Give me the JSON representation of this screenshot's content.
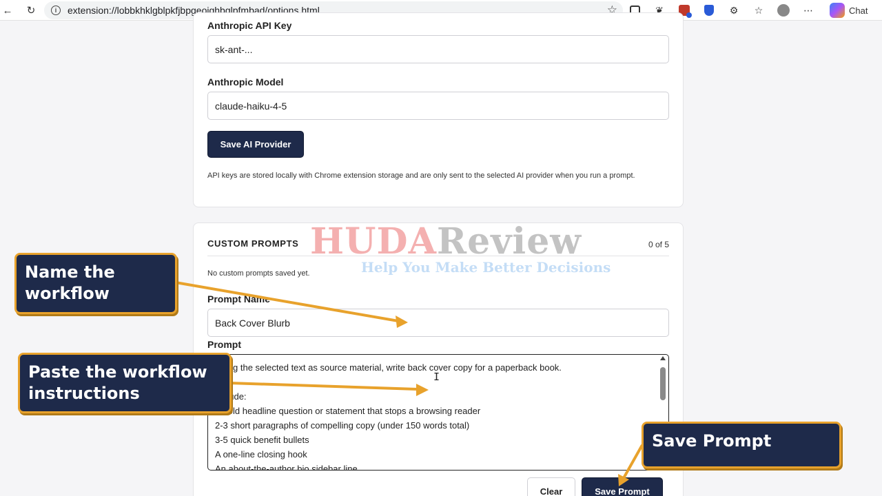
{
  "browser": {
    "url": "extension://lobbkhklgblpkfjbpgeoighbglpfmbad/options.html",
    "chat_label": "Chat",
    "icons": [
      "back-icon",
      "reload-icon",
      "info-icon",
      "star-icon",
      "reader-icon",
      "extension-icon",
      "badge-icon",
      "shield-icon",
      "puzzle-icon",
      "favorites-icon",
      "profile-icon",
      "more-icon",
      "copilot-icon"
    ]
  },
  "ai_provider": {
    "api_key_label": "Anthropic API Key",
    "api_key_value": "sk-ant-...",
    "model_label": "Anthropic Model",
    "model_value": "claude-haiku-4-5",
    "save_button": "Save AI Provider",
    "note": "API keys are stored locally with Chrome extension storage and are only sent to the selected AI provider when you run a prompt."
  },
  "custom_prompts": {
    "heading": "CUSTOM PROMPTS",
    "count": "0 of 5",
    "empty_note": "No custom prompts saved yet.",
    "name_label": "Prompt Name",
    "name_value": "Back Cover Blurb",
    "prompt_label": "Prompt",
    "prompt_lines": [
      "Using the selected text as source material, write back cover copy for a paperback book.",
      "",
      "Include:",
      "A bold headline question or statement that stops a browsing reader",
      "2-3 short paragraphs of compelling copy (under 150 words total)",
      "3-5 quick benefit bullets",
      "A one-line closing hook",
      "An about-the-author bio sidebar line"
    ],
    "clear_button": "Clear",
    "save_button": "Save Prompt"
  },
  "watermark": {
    "brand_a": "HUDA",
    "brand_b": "Review",
    "tagline": "Help You Make Better Decisions"
  },
  "callouts": {
    "name": "Name the workflow",
    "paste": "Paste the workflow instructions",
    "save": "Save Prompt"
  },
  "colors": {
    "button_dark": "#1e2a4a",
    "callout_border": "#e8a22c",
    "callout_bg": "#1e2a4a"
  }
}
